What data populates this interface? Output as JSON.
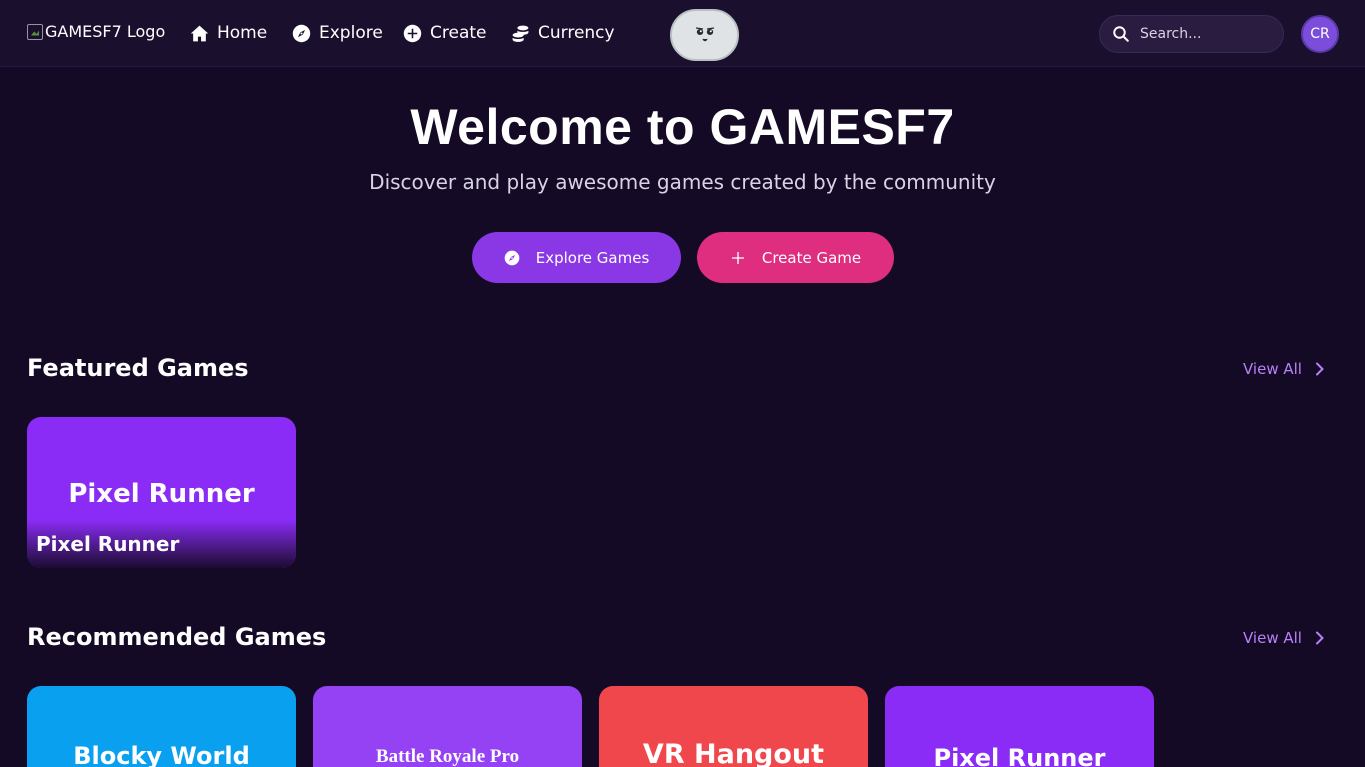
{
  "nav": {
    "logo_alt": "GAMESF7 Logo",
    "links": [
      {
        "label": "Home",
        "icon": "home-icon"
      },
      {
        "label": "Explore",
        "icon": "compass-icon"
      },
      {
        "label": "Create",
        "icon": "plus-circle-icon"
      },
      {
        "label": "Currency",
        "icon": "coins-icon"
      }
    ],
    "search_placeholder": "Search...",
    "avatar_initials": "CR"
  },
  "hero": {
    "title": "Welcome to GAMESF7",
    "subtitle": "Discover and play awesome games created by the community",
    "explore_button": "Explore Games",
    "create_button": "Create Game"
  },
  "featured": {
    "title": "Featured Games",
    "view_all": "View All",
    "games": [
      {
        "art_title": "Pixel Runner",
        "name": "Pixel Runner",
        "color": "#8a2cf5"
      }
    ]
  },
  "recommended": {
    "title": "Recommended Games",
    "view_all": "View All",
    "games": [
      {
        "art_title": "Blocky World",
        "color": "#0aa0f0"
      },
      {
        "art_title": "Battle Royale Pro",
        "color": "#9442f3"
      },
      {
        "art_title": "VR Hangout",
        "color": "#f0474c"
      },
      {
        "art_title": "Pixel Runner",
        "color": "#8a2cf5"
      }
    ]
  },
  "colors": {
    "background": "#150a25",
    "accent_purple": "#8a37e6",
    "accent_pink": "#df2d7f",
    "link_purple": "#b583f7"
  }
}
